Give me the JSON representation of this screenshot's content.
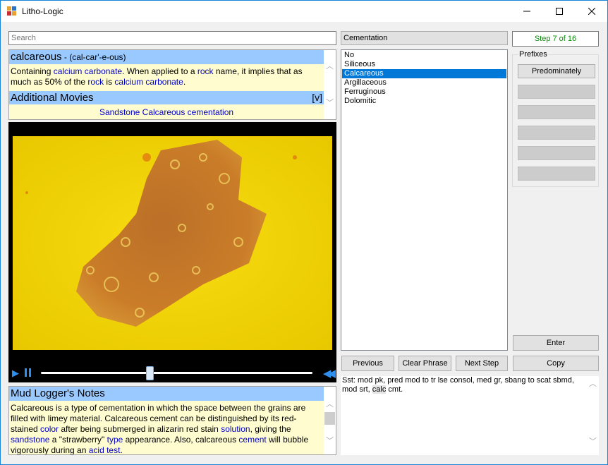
{
  "window": {
    "title": "Litho-Logic",
    "minimize_glyph": "─",
    "maximize_glyph": "☐",
    "close_glyph": "✕"
  },
  "search": {
    "placeholder": "Search",
    "value": ""
  },
  "definition": {
    "word": "calcareous",
    "pronunciation": " - (cal-car'-e-ous)",
    "body_1": "Containing ",
    "link_1": "calcium carbonate",
    "body_2": ". When applied to a ",
    "link_2": "rock",
    "body_3": " name, it implies that as much as 50% of the ",
    "link_3": "rock",
    "body_4": " is ",
    "link_4": "calcium carbonate",
    "body_5": ".",
    "movies_heading": "Additional Movies",
    "movies_toggle": "[v]",
    "movie_link": "Sandstone Calcareous cementation"
  },
  "video": {
    "play_glyph": "▶",
    "rewind_glyph": "◀◀",
    "progress": 0.4
  },
  "notes": {
    "heading": "Mud Logger's Notes",
    "t1": "Calcareous is a type of cementation in which the space between the grains are filled with limey material. Calcareous cement can be distinguished by its red-stained ",
    "l1": "color",
    "t2": " after being submerged in alizarin red stain ",
    "l2": "solution",
    "t3": ", giving the ",
    "l3": "sandstone",
    "t4": " a \"strawberry\" ",
    "l4": "type",
    "t5": " appearance. Also, calcareous ",
    "l5": "cement",
    "t6": " will bubble vigorously during an ",
    "l6": "acid test",
    "t7": "."
  },
  "cementation": {
    "label": "Cementation",
    "options": [
      "No",
      "Siliceous",
      "Calcareous",
      "Argillaceous",
      "Ferruginous",
      "Dolomitic"
    ],
    "selected": "Calcareous"
  },
  "step": {
    "text": "Step 7 of 16"
  },
  "prefixes": {
    "legend": "Prefixes",
    "buttons": [
      "Predominately",
      "",
      "",
      "",
      "",
      ""
    ]
  },
  "buttons": {
    "enter": "Enter",
    "previous": "Previous",
    "clear_phrase": "Clear Phrase",
    "next_step": "Next Step",
    "copy": "Copy"
  },
  "output": {
    "before": "Sst: mod pk, pred mod to tr lse consol, med gr, sbang to scat sbmd, mod srt, ",
    "highlight": "calc",
    "after": " cmt."
  },
  "colors": {
    "accent": "#0078d7",
    "header_blue": "#99c9ff",
    "note_bg": "#fffdd0",
    "link": "#0000cd",
    "step_green": "#009000",
    "video_yellow": "#f0d000"
  }
}
